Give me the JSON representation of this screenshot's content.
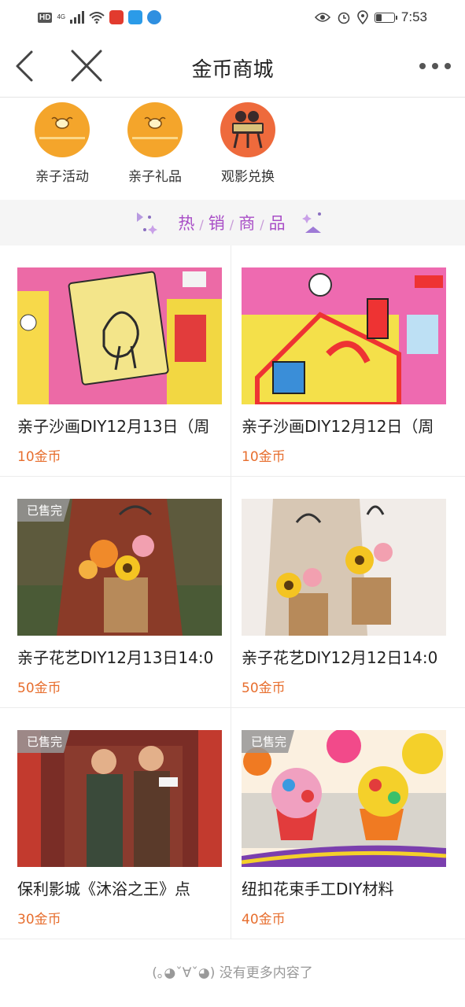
{
  "status_bar": {
    "hd": "HD",
    "network": "4G",
    "time": "7:53"
  },
  "nav": {
    "title": "金币商城"
  },
  "categories": [
    {
      "label": "亲子活动",
      "icon": "bee-logo-icon"
    },
    {
      "label": "亲子礼品",
      "icon": "bee-logo-icon"
    },
    {
      "label": "观影兑换",
      "icon": "film-camera-icon"
    }
  ],
  "hot_section": {
    "chars": [
      "热",
      "销",
      "商",
      "品"
    ],
    "separator": "/"
  },
  "products": [
    {
      "title": "亲子沙画DIY12月13日（周",
      "price": "10金币",
      "sold_out": ""
    },
    {
      "title": "亲子沙画DIY12月12日（周",
      "price": "10金币",
      "sold_out": ""
    },
    {
      "title": "亲子花艺DIY12月13日14:0",
      "price": "50金币",
      "sold_out": "已售完"
    },
    {
      "title": "亲子花艺DIY12月12日14:0",
      "price": "50金币",
      "sold_out": ""
    },
    {
      "title": "保利影城《沐浴之王》点",
      "price": "30金币",
      "sold_out": "已售完"
    },
    {
      "title": "纽扣花束手工DIY材料",
      "price": "40金币",
      "sold_out": "已售完"
    }
  ],
  "footer": {
    "text": "(｡◕ˇ∀ˇ◕) 没有更多内容了"
  },
  "colors": {
    "accent_price": "#e76e2e",
    "hot_title": "#a94fc7",
    "category_orange": "#f4a52b",
    "category_film": "#ee6a3c"
  }
}
